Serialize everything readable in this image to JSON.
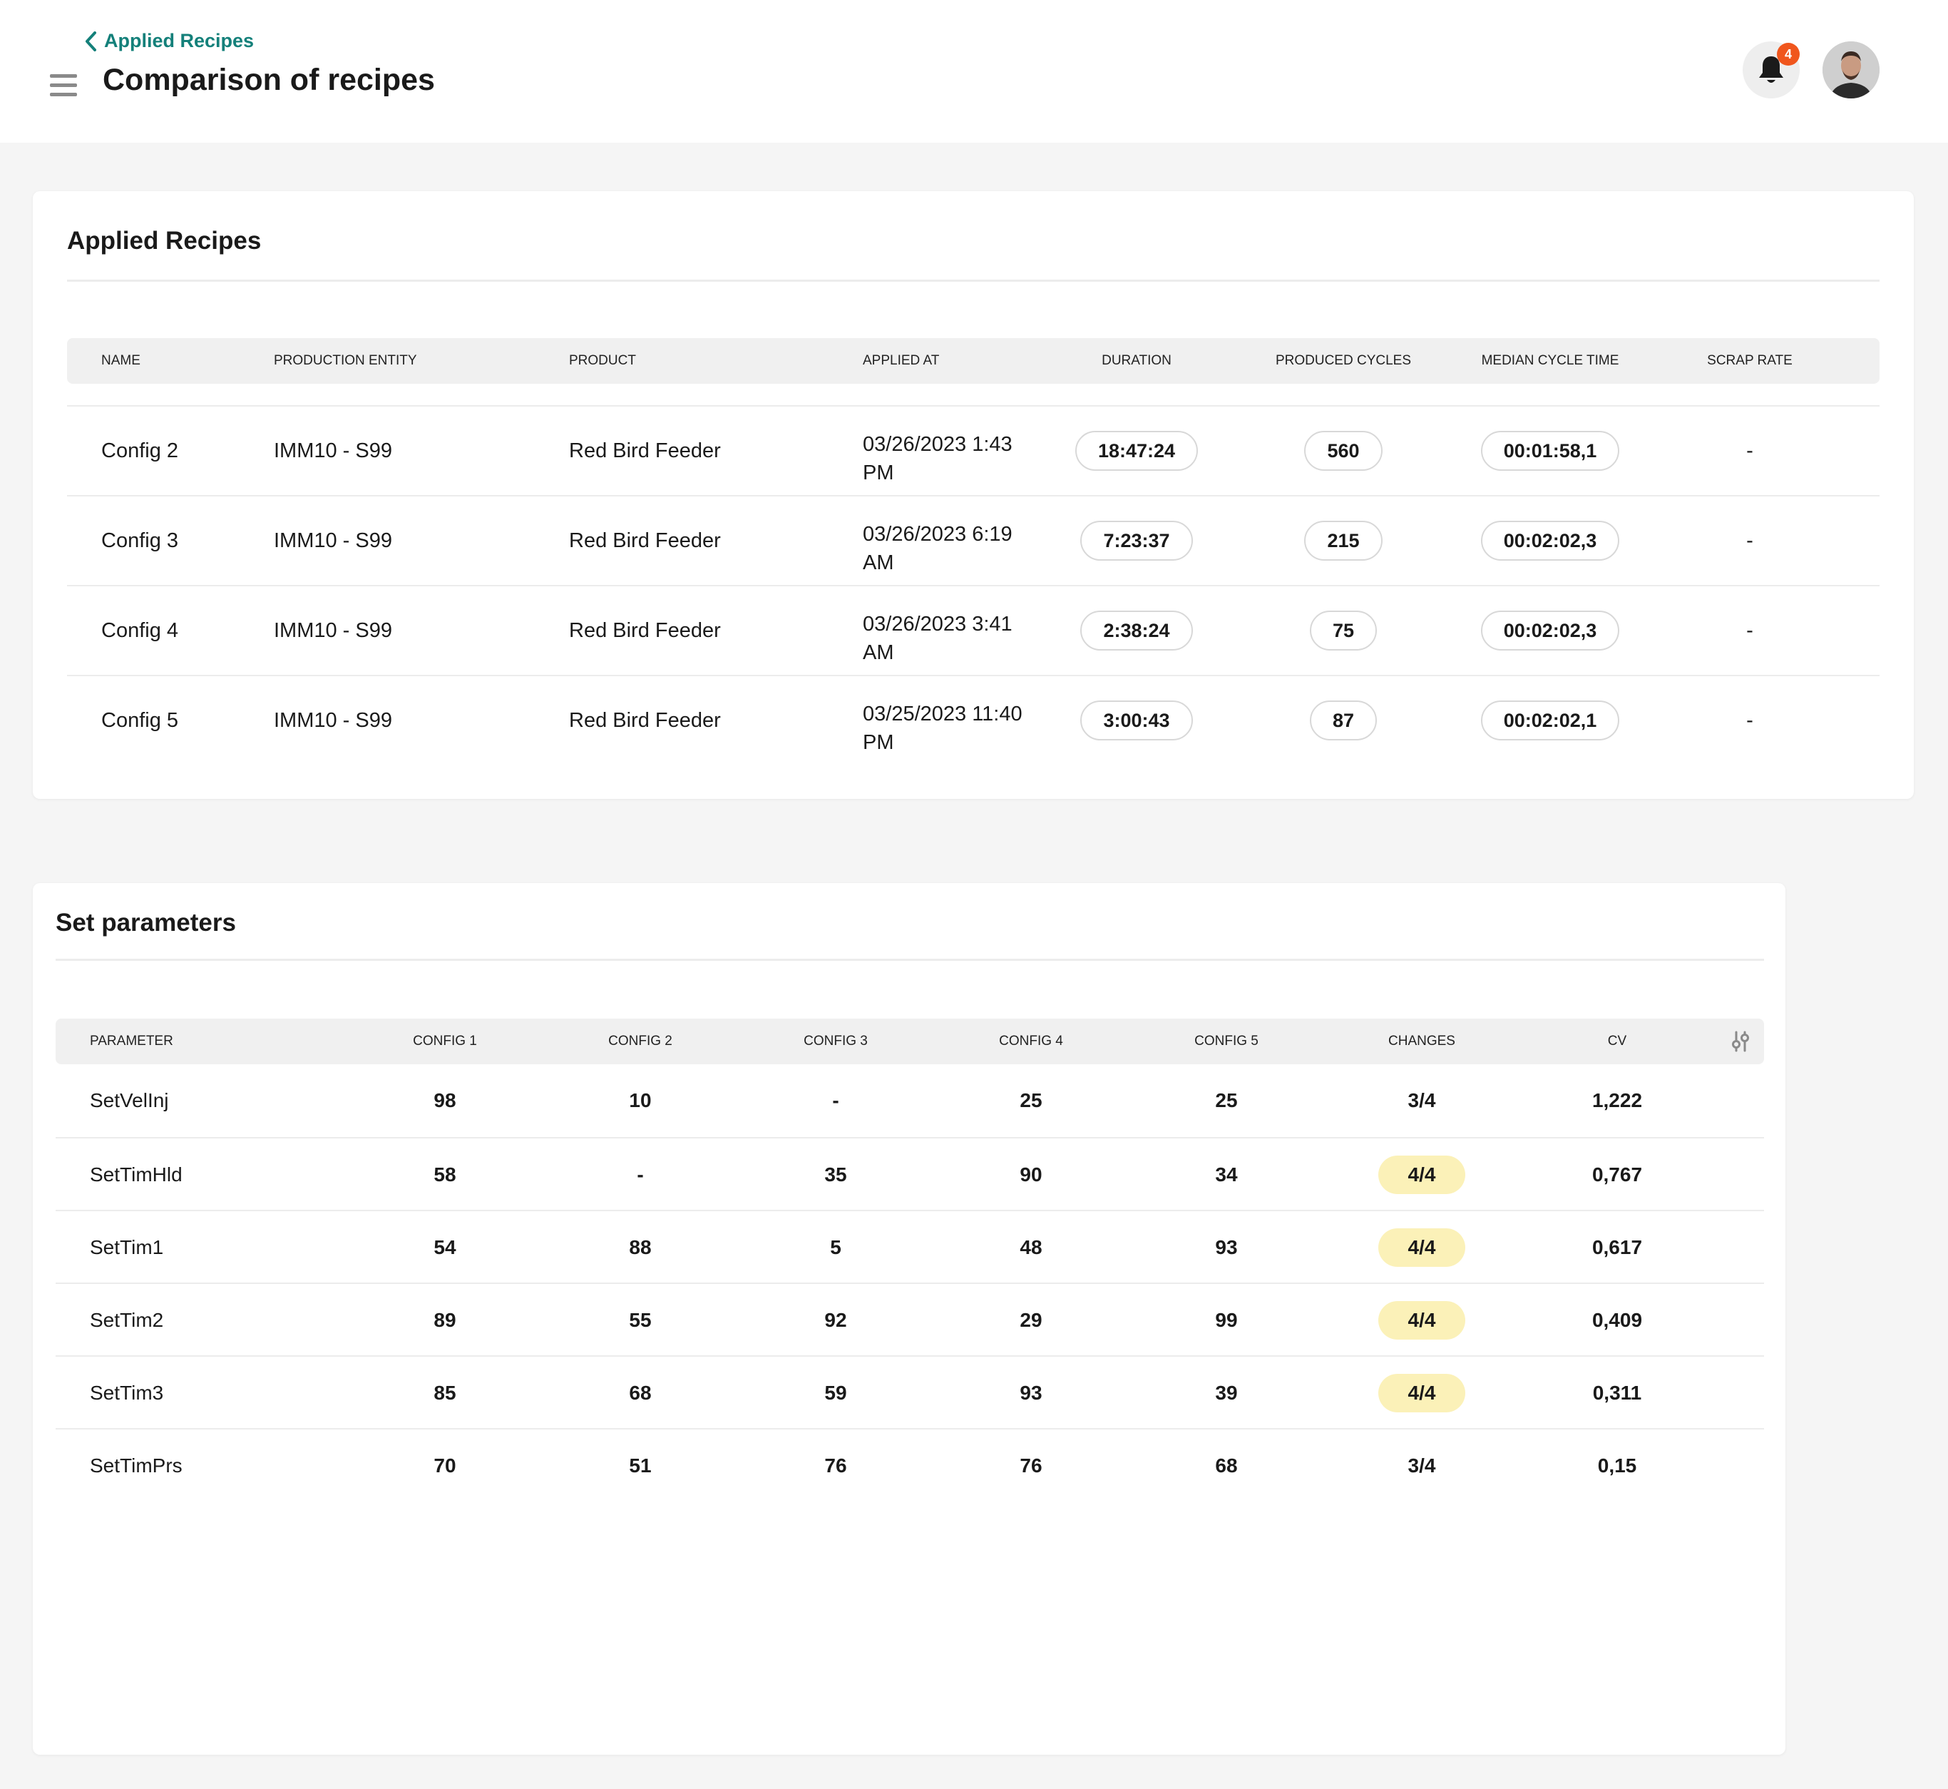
{
  "header": {
    "back_label": "Applied Recipes",
    "title": "Comparison of recipes",
    "notification_count": "4"
  },
  "recipes": {
    "title": "Applied Recipes",
    "columns": [
      "NAME",
      "PRODUCTION ENTITY",
      "PRODUCT",
      "APPLIED AT",
      "DURATION",
      "PRODUCED CYCLES",
      "MEDIAN CYCLE TIME",
      "SCRAP RATE"
    ],
    "rows": [
      {
        "name": "Config 2",
        "entity": "IMM10 - S99",
        "product": "Red Bird Feeder",
        "applied_at_1": "03/26/2023 1:43",
        "applied_at_2": "PM",
        "duration": "18:47:24",
        "cycles": "560",
        "median": "00:01:58,1",
        "scrap": "-"
      },
      {
        "name": "Config 3",
        "entity": "IMM10 - S99",
        "product": "Red Bird Feeder",
        "applied_at_1": "03/26/2023 6:19",
        "applied_at_2": "AM",
        "duration": "7:23:37",
        "cycles": "215",
        "median": "00:02:02,3",
        "scrap": "-"
      },
      {
        "name": "Config 4",
        "entity": "IMM10 - S99",
        "product": "Red Bird Feeder",
        "applied_at_1": "03/26/2023 3:41",
        "applied_at_2": "AM",
        "duration": "2:38:24",
        "cycles": "75",
        "median": "00:02:02,3",
        "scrap": "-"
      },
      {
        "name": "Config 5",
        "entity": "IMM10 - S99",
        "product": "Red Bird Feeder",
        "applied_at_1": "03/25/2023 11:40",
        "applied_at_2": "PM",
        "duration": "3:00:43",
        "cycles": "87",
        "median": "00:02:02,1",
        "scrap": "-"
      }
    ]
  },
  "params": {
    "title": "Set parameters",
    "columns": [
      "PARAMETER",
      "CONFIG 1",
      "CONFIG 2",
      "CONFIG 3",
      "CONFIG 4",
      "CONFIG 5",
      "CHANGES",
      "CV"
    ],
    "rows": [
      {
        "name": "SetVelInj",
        "c1": "98",
        "c2": "10",
        "c3": "-",
        "c4": "25",
        "c5": "25",
        "changes": "3/4",
        "cv": "1,222"
      },
      {
        "name": "SetTimHld",
        "c1": "58",
        "c2": "-",
        "c3": "35",
        "c4": "90",
        "c5": "34",
        "changes": "4/4",
        "cv": "0,767"
      },
      {
        "name": "SetTim1",
        "c1": "54",
        "c2": "88",
        "c3": "5",
        "c4": "48",
        "c5": "93",
        "changes": "4/4",
        "cv": "0,617"
      },
      {
        "name": "SetTim2",
        "c1": "89",
        "c2": "55",
        "c3": "92",
        "c4": "29",
        "c5": "99",
        "changes": "4/4",
        "cv": "0,409"
      },
      {
        "name": "SetTim3",
        "c1": "85",
        "c2": "68",
        "c3": "59",
        "c4": "93",
        "c5": "39",
        "changes": "4/4",
        "cv": "0,311"
      },
      {
        "name": "SetTimPrs",
        "c1": "70",
        "c2": "51",
        "c3": "76",
        "c4": "76",
        "c5": "68",
        "changes": "3/4",
        "cv": "0,15"
      }
    ]
  },
  "colors": {
    "accent": "#14807a",
    "badge": "#f0561d",
    "highlight": "#fbf1b8"
  },
  "icons": {
    "back": "chevron-left-icon",
    "menu": "hamburger-menu-icon",
    "bell": "bell-icon",
    "filter": "sliders-icon"
  }
}
